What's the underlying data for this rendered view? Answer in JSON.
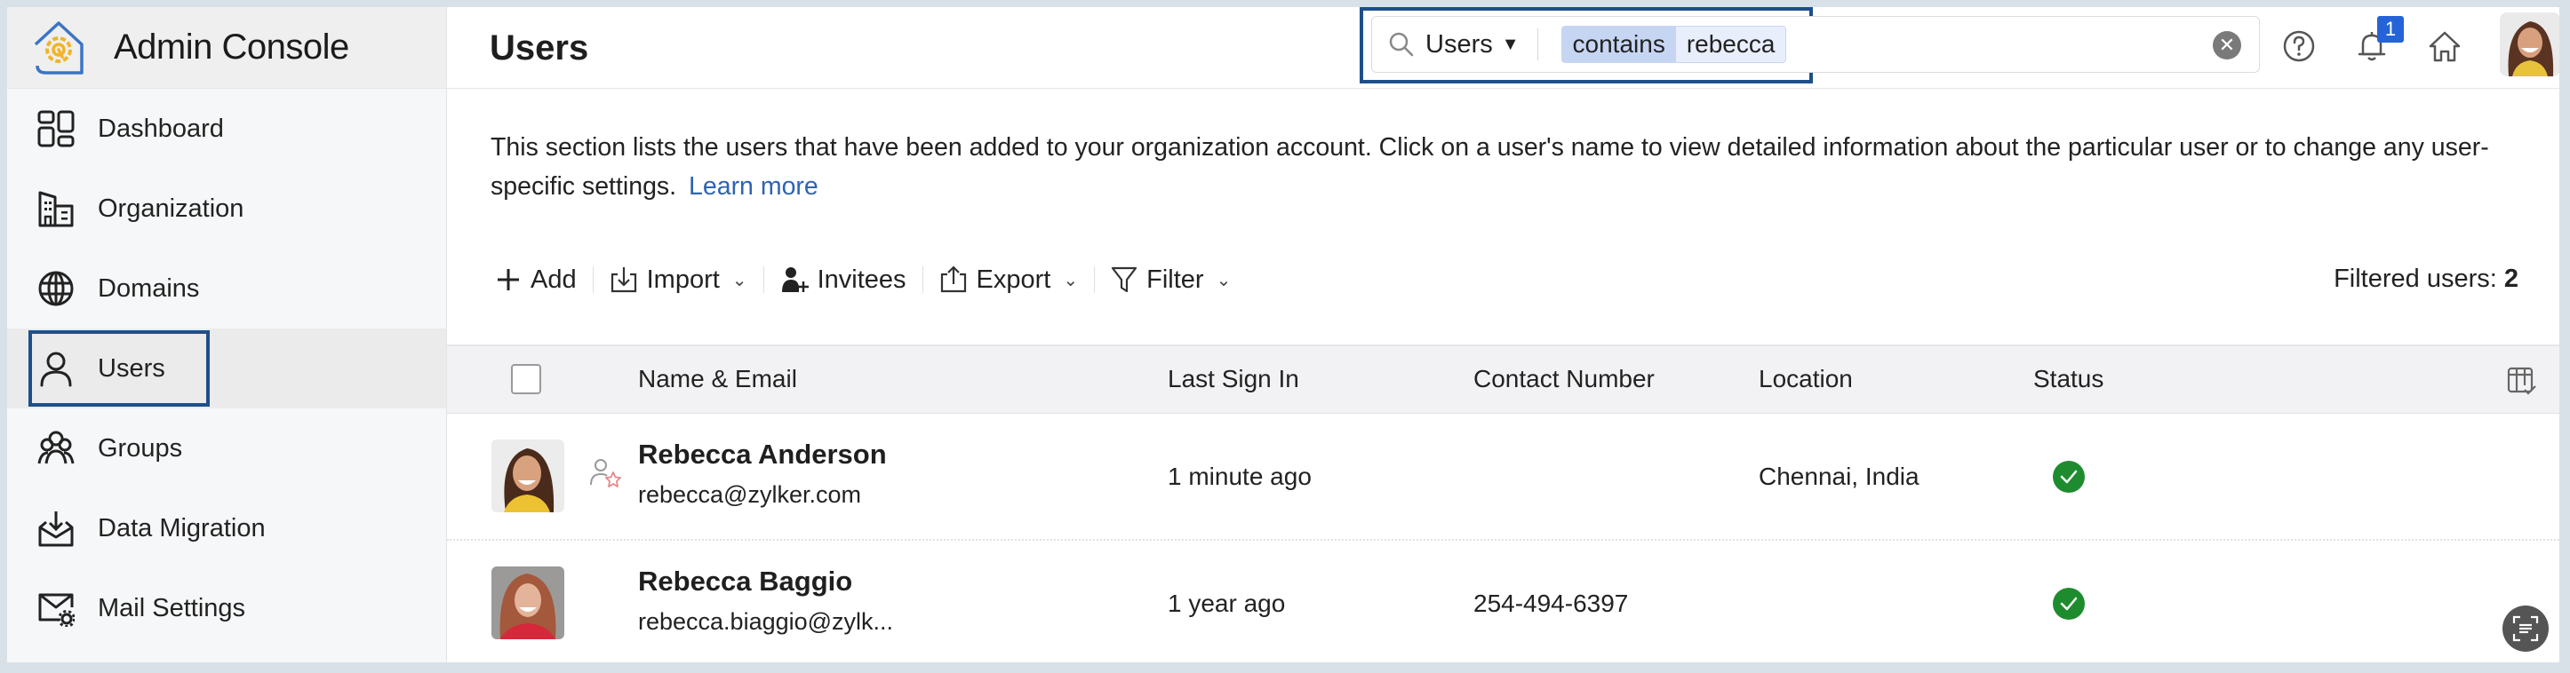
{
  "app": {
    "title": "Admin Console"
  },
  "sidebar": {
    "items": [
      {
        "label": "Dashboard",
        "icon": "dashboard-icon"
      },
      {
        "label": "Organization",
        "icon": "building-icon"
      },
      {
        "label": "Domains",
        "icon": "globe-icon"
      },
      {
        "label": "Users",
        "icon": "user-icon",
        "active": true
      },
      {
        "label": "Groups",
        "icon": "groups-icon"
      },
      {
        "label": "Data Migration",
        "icon": "inbox-download-icon"
      },
      {
        "label": "Mail Settings",
        "icon": "mail-settings-icon"
      }
    ]
  },
  "header": {
    "page_title": "Users",
    "search": {
      "scope": "Users",
      "operator": "contains",
      "value": "rebecca"
    },
    "notification_count": "1"
  },
  "main": {
    "description": "This section lists the users that have been added to your organization account. Click on a user's name to view detailed information about the particular user or to change any user-specific settings.",
    "learn_more": "Learn more",
    "toolbar": {
      "add": "Add",
      "import": "Import",
      "invitees": "Invitees",
      "export": "Export",
      "filter": "Filter"
    },
    "filtered_label": "Filtered users:",
    "filtered_count": "2"
  },
  "table": {
    "columns": {
      "name_email": "Name & Email",
      "last_sign_in": "Last Sign In",
      "contact": "Contact Number",
      "location": "Location",
      "status": "Status"
    },
    "rows": [
      {
        "name": "Rebecca Anderson",
        "email": "rebecca@zylker.com",
        "last_sign_in": "1 minute ago",
        "contact": "",
        "location": "Chennai, India",
        "status": "active",
        "is_admin": true
      },
      {
        "name": "Rebecca Baggio",
        "email": "rebecca.biaggio@zylk...",
        "last_sign_in": "1 year ago",
        "contact": "254-494-6397",
        "location": "",
        "status": "active",
        "is_admin": false
      }
    ]
  },
  "colors": {
    "accent_blue": "#2d64b3",
    "highlight_border": "#1e4f8a",
    "status_active": "#1e8c2e",
    "badge_blue": "#2563d8"
  }
}
